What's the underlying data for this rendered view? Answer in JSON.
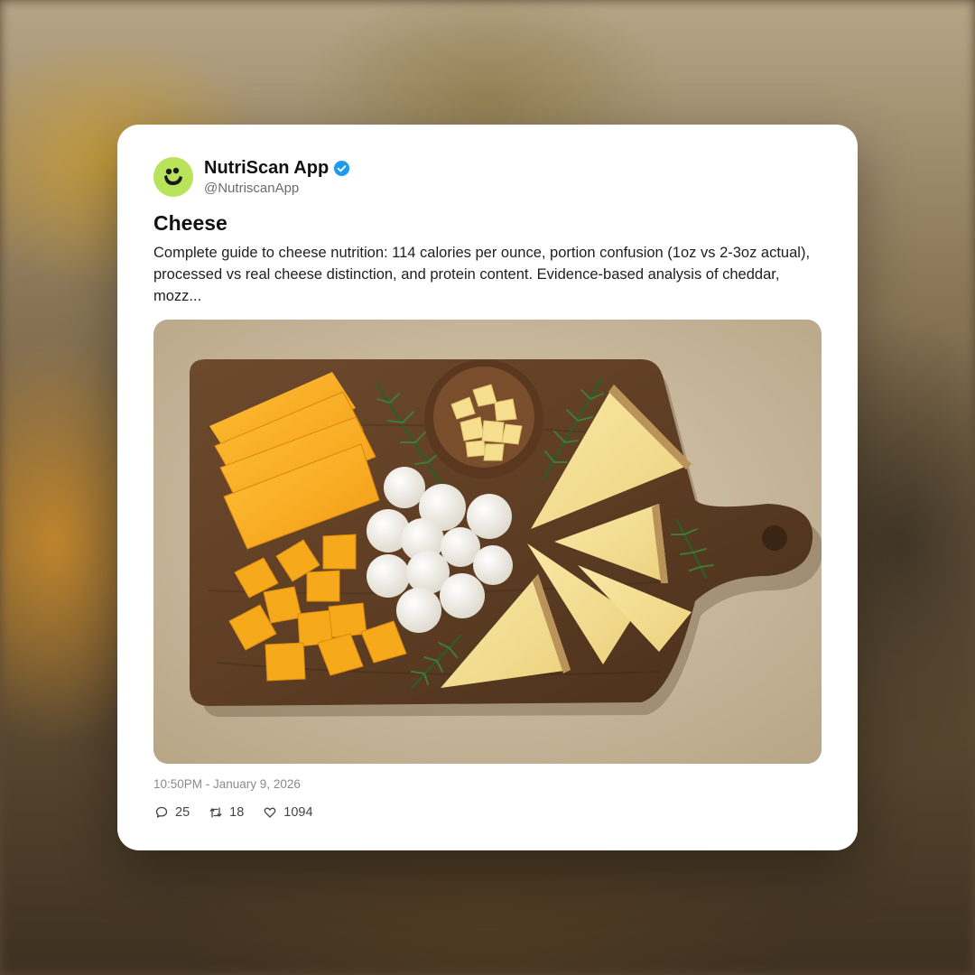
{
  "post": {
    "author": {
      "display_name": "NutriScan App",
      "handle": "@NutriscanApp",
      "verified": true,
      "avatar_icon": "nutriscan-logo-icon"
    },
    "title": "Cheese",
    "body": "Complete guide to cheese nutrition: 114 calories per ounce, portion confusion (1oz vs 2-3oz actual), processed vs real cheese distinction, and protein content. Evidence-based analysis of cheddar, mozz...",
    "timestamp": "10:50PM - January 9, 2026",
    "stats": {
      "replies": "25",
      "retweets": "18",
      "likes": "1094"
    }
  },
  "colors": {
    "avatar_bg": "#b9e35a",
    "verified": "#1d9bf0",
    "card_bg": "#ffffff"
  }
}
